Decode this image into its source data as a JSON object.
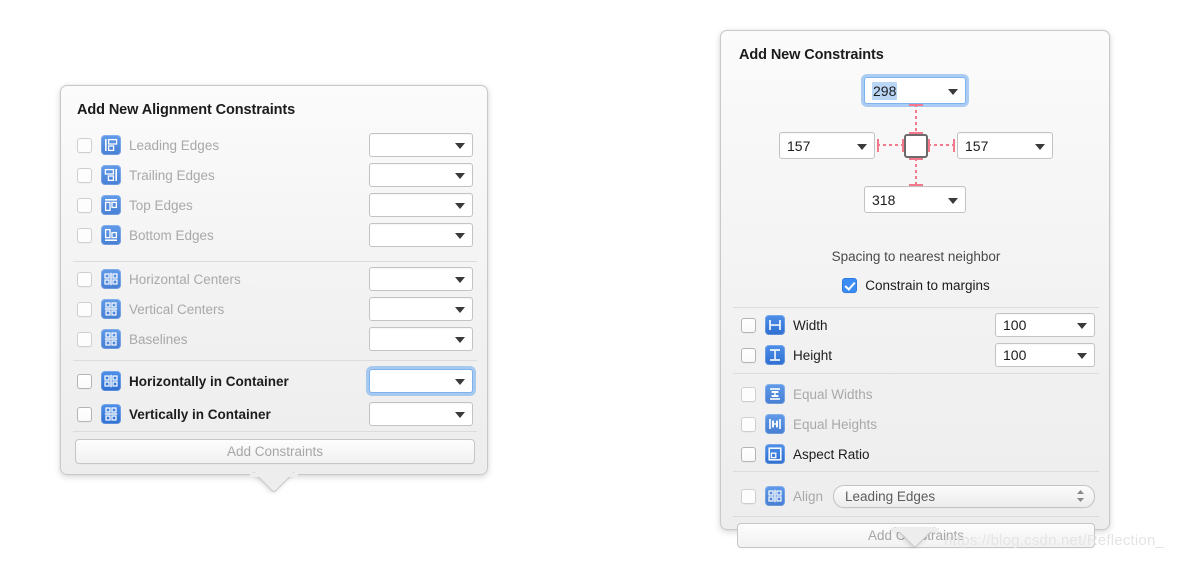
{
  "alignment_panel": {
    "title": "Add New Alignment Constraints",
    "rows": [
      {
        "label": "Leading Edges",
        "icon": "align-leading-edges-icon",
        "state": "disabled",
        "checked": false,
        "field_value": "",
        "field_focused": false
      },
      {
        "label": "Trailing Edges",
        "icon": "align-trailing-edges-icon",
        "state": "disabled",
        "checked": false,
        "field_value": "",
        "field_focused": false
      },
      {
        "label": "Top Edges",
        "icon": "align-top-edges-icon",
        "state": "disabled",
        "checked": false,
        "field_value": "",
        "field_focused": false
      },
      {
        "label": "Bottom Edges",
        "icon": "align-bottom-edges-icon",
        "state": "disabled",
        "checked": false,
        "field_value": "",
        "field_focused": false
      },
      {
        "label": "Horizontal Centers",
        "icon": "align-horizontal-centers-icon",
        "state": "disabled",
        "checked": false,
        "field_value": "",
        "field_focused": false
      },
      {
        "label": "Vertical Centers",
        "icon": "align-vertical-centers-icon",
        "state": "disabled",
        "checked": false,
        "field_value": "",
        "field_focused": false
      },
      {
        "label": "Baselines",
        "icon": "align-baselines-icon",
        "state": "disabled",
        "checked": false,
        "field_value": "",
        "field_focused": false
      },
      {
        "label": "Horizontally in Container",
        "icon": "align-horizontal-centers-icon",
        "state": "enabled",
        "checked": false,
        "field_value": "",
        "field_focused": true
      },
      {
        "label": "Vertically in Container",
        "icon": "align-vertical-centers-icon",
        "state": "enabled",
        "checked": false,
        "field_value": "",
        "field_focused": false
      }
    ],
    "add_button_label": "Add Constraints"
  },
  "constraints_panel": {
    "title": "Add New Constraints",
    "spacing": {
      "top_value": "298",
      "top_selected": true,
      "left_value": "157",
      "right_value": "157",
      "bottom_value": "318",
      "caption": "Spacing to nearest neighbor",
      "constrain_to_margins_label": "Constrain to margins",
      "constrain_to_margins_checked": true
    },
    "size_rows": [
      {
        "label": "Width",
        "icon": "width-icon",
        "state": "enabled",
        "checked": false,
        "field_value": "100"
      },
      {
        "label": "Height",
        "icon": "height-icon",
        "state": "enabled",
        "checked": false,
        "field_value": "100"
      }
    ],
    "relation_rows": [
      {
        "label": "Equal Widths",
        "icon": "equal-widths-icon",
        "state": "disabled",
        "checked": false
      },
      {
        "label": "Equal Heights",
        "icon": "equal-heights-icon",
        "state": "disabled",
        "checked": false
      },
      {
        "label": "Aspect Ratio",
        "icon": "aspect-ratio-icon",
        "state": "enabled",
        "checked": false
      }
    ],
    "align_row": {
      "label": "Align",
      "icon": "align-horizontal-centers-icon",
      "state": "disabled",
      "checked": false,
      "selected_option": "Leading Edges"
    },
    "add_button_label": "Add Constraints"
  },
  "watermark": "https://blog.csdn.net/Reflection_",
  "colors": {
    "accent_blue": "#3b8cf4",
    "icon_blue": "#2f6fd0",
    "focus_ring": "#7eb3ef",
    "spacing_connector": "#f4788c",
    "selection_highlight": "#b9d6f7",
    "panel_bg": "#ededed",
    "disabled_text": "#a9a9a9"
  }
}
